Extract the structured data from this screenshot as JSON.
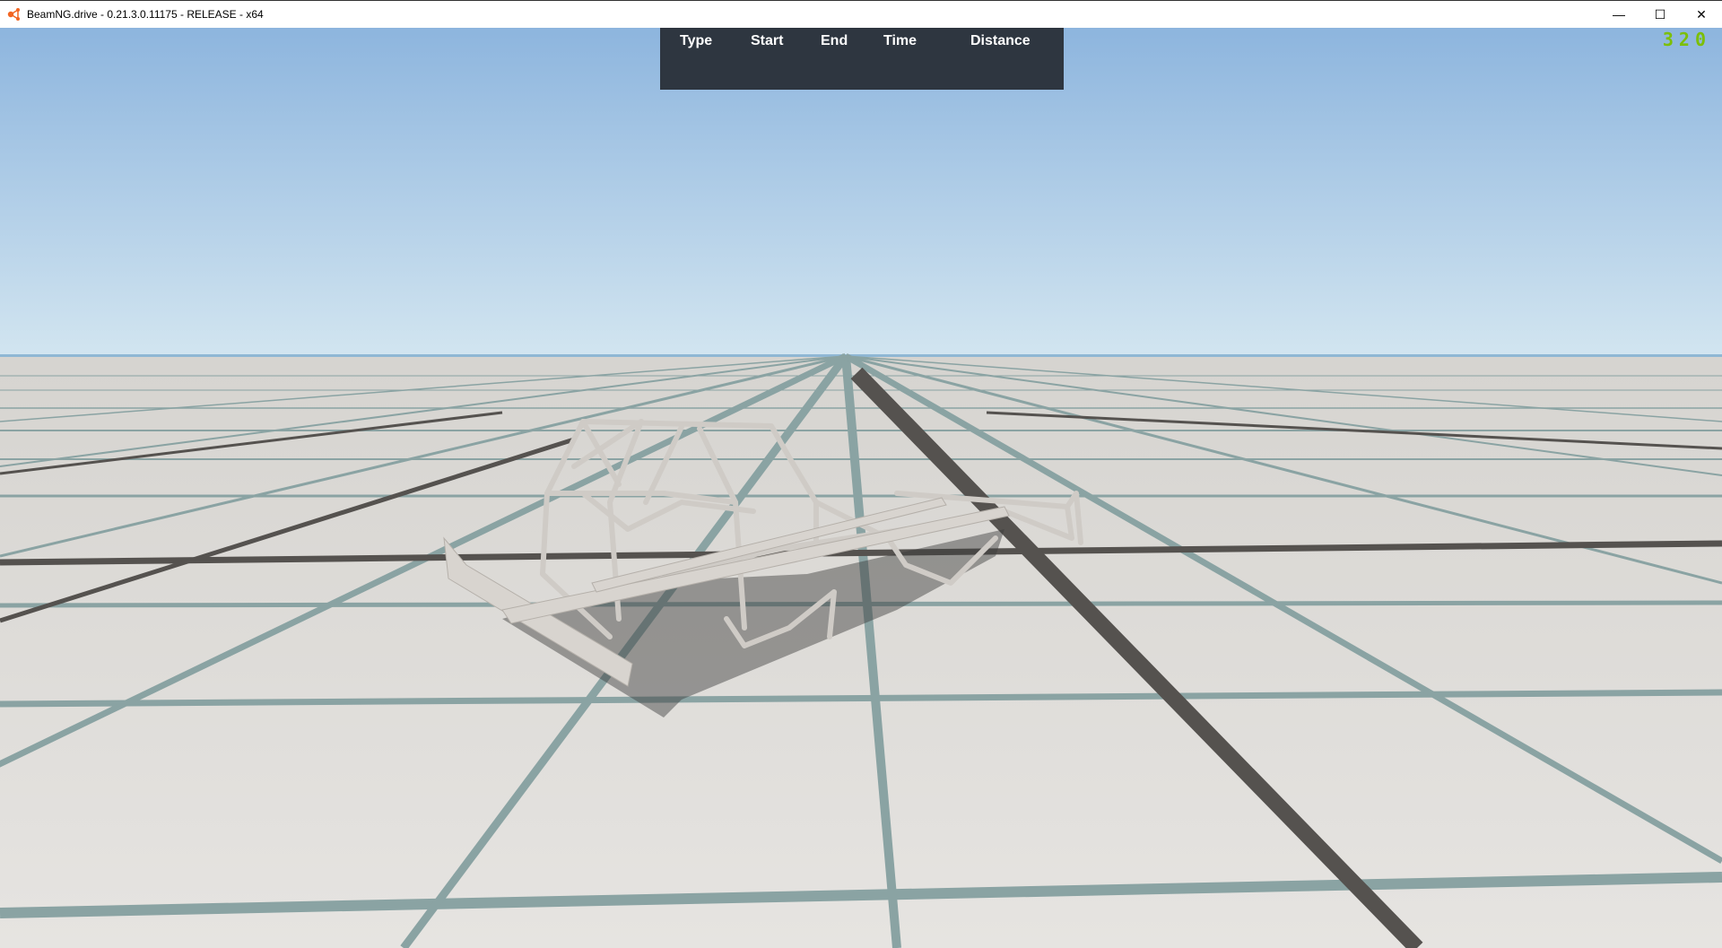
{
  "window": {
    "title": "BeamNG.drive - 0.21.3.0.11175 - RELEASE - x64",
    "controls": {
      "minimize": "—",
      "maximize": "☐",
      "close": "✕"
    }
  },
  "hud": {
    "columns": [
      "Type",
      "Start",
      "End",
      "Time",
      "Distance"
    ],
    "fps": "320"
  },
  "colors": {
    "panel": "#2e3640",
    "fps": "#7cbf00",
    "sky_top": "#8db5de",
    "sky_horizon": "#d2e5f0",
    "ground": "#dedcd8"
  }
}
